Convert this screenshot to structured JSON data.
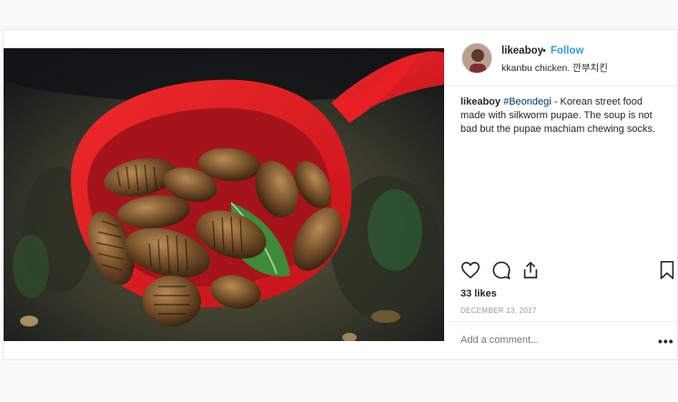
{
  "post": {
    "username": "likeaboy",
    "dot": "•",
    "follow_label": "Follow",
    "location": "kkanbu chicken. 깐부치킨",
    "caption": {
      "username": "likeaboy",
      "hashtag": "#Beondegi",
      "text": " - Korean street food made with silkworm pupae. The soup is not bad but the pupae machiam chewing socks."
    },
    "icons": {
      "like": "heart-icon",
      "comment": "comment-icon",
      "share": "share-icon",
      "save": "bookmark-icon"
    },
    "likes": "33 likes",
    "date": "DECEMBER 13, 2017",
    "comment_placeholder": "Add a comment...",
    "more_label": "•••",
    "photo_subject": "Silkworm pupae (beondegi) in a red ladle over soup"
  }
}
